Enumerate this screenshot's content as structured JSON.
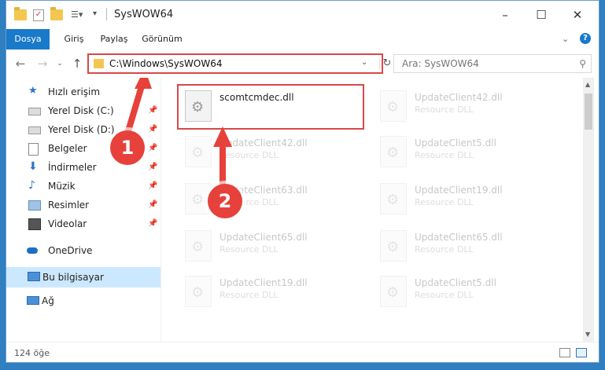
{
  "window": {
    "title": "SysWOW64"
  },
  "ribbon": {
    "tabs": [
      "Dosya",
      "Giriş",
      "Paylaş",
      "Görünüm"
    ]
  },
  "address": {
    "path": "C:\\Windows\\SysWOW64",
    "search_placeholder": "Ara: SysWOW64"
  },
  "sidebar": {
    "items": [
      {
        "label": "Hızlı erişim",
        "icon": "star-icon"
      },
      {
        "label": "Yerel Disk (C:)",
        "icon": "drive-icon"
      },
      {
        "label": "Yerel Disk (D:)",
        "icon": "drive-icon"
      },
      {
        "label": "Belgeler",
        "icon": "document-icon"
      },
      {
        "label": "İndirmeler",
        "icon": "download-icon"
      },
      {
        "label": "Müzik",
        "icon": "music-icon"
      },
      {
        "label": "Resimler",
        "icon": "pictures-icon"
      },
      {
        "label": "Videolar",
        "icon": "video-icon"
      },
      {
        "label": "OneDrive",
        "icon": "cloud-icon"
      },
      {
        "label": "Bu bilgisayar",
        "icon": "computer-icon"
      },
      {
        "label": "Ağ",
        "icon": "network-icon"
      }
    ]
  },
  "files": [
    {
      "name": "scomtcmdec.dll",
      "type": ""
    },
    {
      "name": "UpdateClient42.dll",
      "type": "Resource DLL"
    },
    {
      "name": "UpdateClient42.dll",
      "type": "Resource DLL"
    },
    {
      "name": "UpdateClient5.dll",
      "type": "Resource DLL"
    },
    {
      "name": "UpdateClient63.dll",
      "type": "Resource DLL"
    },
    {
      "name": "UpdateClient19.dll",
      "type": "Resource DLL"
    },
    {
      "name": "UpdateClient65.dll",
      "type": "Resource DLL"
    },
    {
      "name": "UpdateClient65.dll",
      "type": "Resource DLL"
    },
    {
      "name": "UpdateClient19.dll",
      "type": "Resource DLL"
    },
    {
      "name": "UpdateClient5.dll",
      "type": "Resource DLL"
    }
  ],
  "status": {
    "count": "124 öğe"
  },
  "annotations": {
    "step1": "1",
    "step2": "2"
  },
  "colors": {
    "accent": "#1979ca",
    "highlight": "#d9484a",
    "badge": "#e7413b"
  }
}
